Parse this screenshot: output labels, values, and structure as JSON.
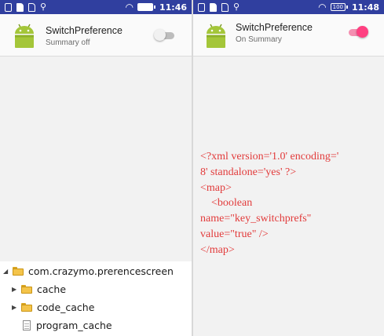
{
  "left_screen": {
    "status_bar": {
      "time": "11:46",
      "battery": ""
    },
    "preference": {
      "title": "SwitchPreference",
      "summary": "Summary off",
      "checked": false
    }
  },
  "right_screen": {
    "status_bar": {
      "time": "11:48",
      "battery": "100"
    },
    "preference": {
      "title": "SwitchPreference",
      "summary": "On Summary",
      "checked": true
    },
    "xml_lines": [
      "<?xml version='1.0' encoding='",
      "8' standalone='yes' ?>",
      "<map>",
      "    <boolean",
      "name=\"key_switchprefs\"",
      "value=\"true\" />",
      "</map>"
    ]
  },
  "file_tree": {
    "root": "com.crazymo.prerencescreen",
    "children": [
      {
        "label": "cache",
        "type": "folder"
      },
      {
        "label": "code_cache",
        "type": "folder"
      },
      {
        "label": "program_cache",
        "type": "file"
      }
    ]
  },
  "colors": {
    "status_bar": "#303f9f",
    "accent": "#ff4081",
    "xml_text": "#e23b3b",
    "android_green": "#a4c639"
  }
}
